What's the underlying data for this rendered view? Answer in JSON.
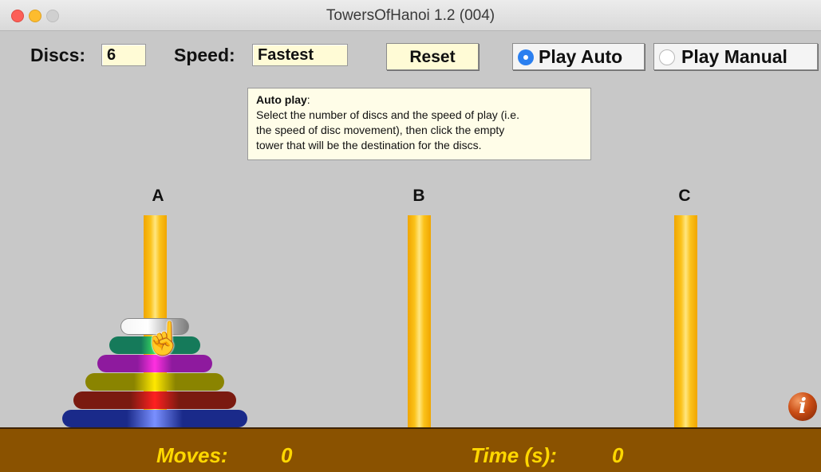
{
  "window": {
    "title": "TowersOfHanoi 1.2 (004)"
  },
  "controls": {
    "discs_label": "Discs:",
    "discs_value": "6",
    "speed_label": "Speed:",
    "speed_value": "Fastest",
    "reset_label": "Reset",
    "play_auto_label": "Play Auto",
    "play_manual_label": "Play Manual",
    "selected_mode": "Play Auto"
  },
  "tooltip": {
    "heading": "Auto play",
    "lines": [
      "Select the number of discs and the speed of play (i.e.",
      "the speed of disc movement), then click the empty",
      "tower that will be the destination for the discs."
    ]
  },
  "towers": [
    {
      "label": "A",
      "disc_count": 6
    },
    {
      "label": "B",
      "disc_count": 0
    },
    {
      "label": "C",
      "disc_count": 0
    }
  ],
  "discs": [
    {
      "size": 1,
      "color": "#e0e0e0",
      "highlight": "#ffffff"
    },
    {
      "size": 2,
      "color": "#157a5a",
      "highlight": "#39e060"
    },
    {
      "size": 3,
      "color": "#8e1a9e",
      "highlight": "#ff30e0"
    },
    {
      "size": 4,
      "color": "#8a8400",
      "highlight": "#ffe800"
    },
    {
      "size": 5,
      "color": "#7a1a10",
      "highlight": "#ff2020"
    },
    {
      "size": 6,
      "color": "#1a2a8a",
      "highlight": "#7a90ff"
    }
  ],
  "status": {
    "moves_label": "Moves:",
    "moves_value": "0",
    "time_label": "Time (s):",
    "time_value": "0"
  },
  "icons": {
    "info": "info-icon",
    "cursor": "hand-pointer-icon"
  },
  "colors": {
    "background": "#c8c8c8",
    "field_bg": "#fffbd6",
    "peg": "#fbc21a",
    "statusbar": "#8a5200",
    "status_text": "#ffd700",
    "radio_selected": "#2a7ff0"
  }
}
